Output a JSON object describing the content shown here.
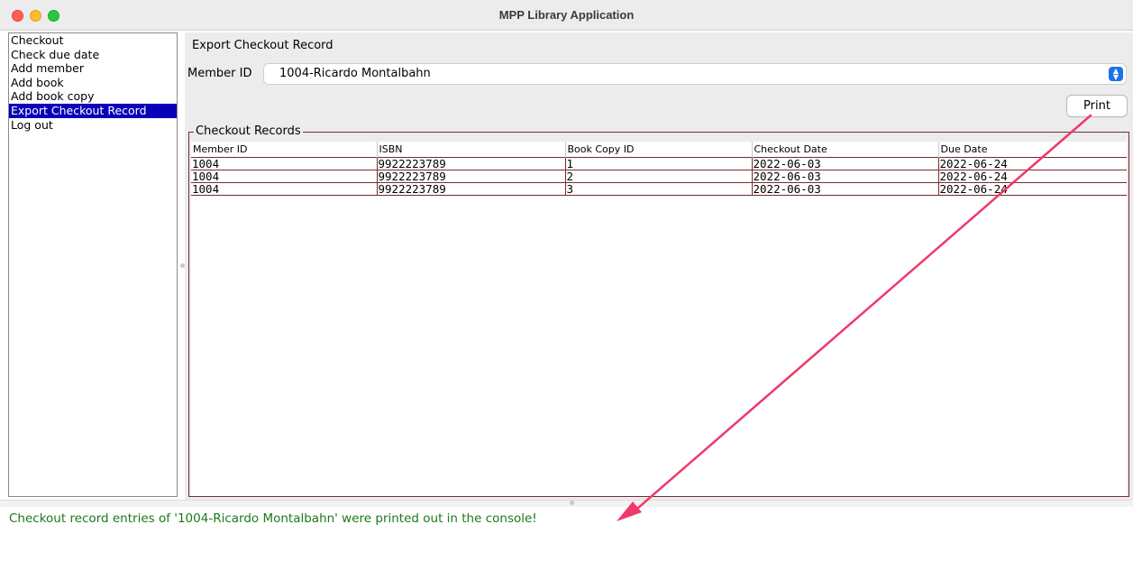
{
  "window": {
    "title": "MPP Library Application"
  },
  "sidebar": {
    "items": [
      {
        "label": "Checkout"
      },
      {
        "label": "Check due date"
      },
      {
        "label": "Add member"
      },
      {
        "label": "Add book"
      },
      {
        "label": "Add book copy"
      },
      {
        "label": "Export Checkout Record"
      },
      {
        "label": "Log out"
      }
    ],
    "selected_index": 5
  },
  "panel": {
    "title": "Export Checkout Record",
    "member_label": "Member ID",
    "member_value": "1004-Ricardo Montalbahn",
    "print_label": "Print",
    "records_title": "Checkout Records"
  },
  "table": {
    "columns": [
      "Member ID",
      "ISBN",
      "Book Copy ID",
      "Checkout Date",
      "Due Date"
    ],
    "rows": [
      [
        "1004",
        "9922223789",
        "1",
        "2022-06-03",
        "2022-06-24"
      ],
      [
        "1004",
        "9922223789",
        "2",
        "2022-06-03",
        "2022-06-24"
      ],
      [
        "1004",
        "9922223789",
        "3",
        "2022-06-03",
        "2022-06-24"
      ]
    ]
  },
  "status": {
    "message": "Checkout record entries of '1004-Ricardo Montalbahn' were printed out in the console!",
    "color": "#1a7a1a"
  },
  "colors": {
    "selection": "#0a00b8",
    "annotation_arrow": "#f0386b",
    "grid": "#7a2a2a"
  }
}
